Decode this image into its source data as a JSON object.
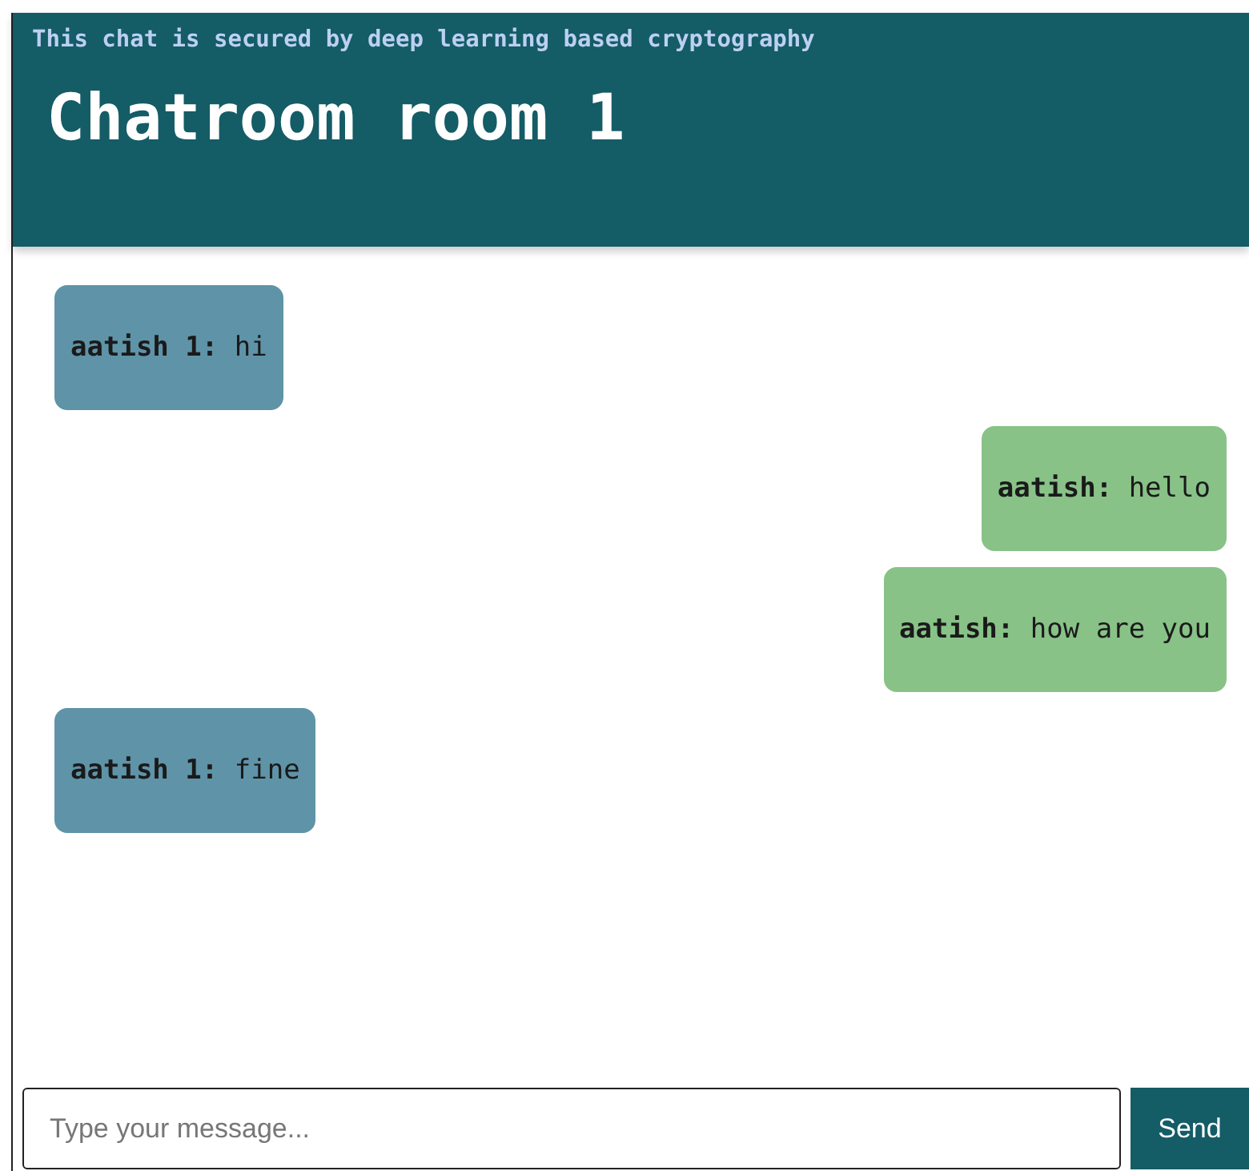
{
  "header": {
    "notice": "This chat is secured by deep learning based cryptography",
    "title": "Chatroom room 1"
  },
  "messages": [
    {
      "kind": "received",
      "sender": "aatish 1:",
      "text": "hi"
    },
    {
      "kind": "sent",
      "sender": "aatish:",
      "text": "hello"
    },
    {
      "kind": "sent",
      "sender": "aatish:",
      "text": "how are you"
    },
    {
      "kind": "received",
      "sender": "aatish 1:",
      "text": "fine"
    }
  ],
  "composer": {
    "placeholder": "Type your message...",
    "button": "Send"
  }
}
